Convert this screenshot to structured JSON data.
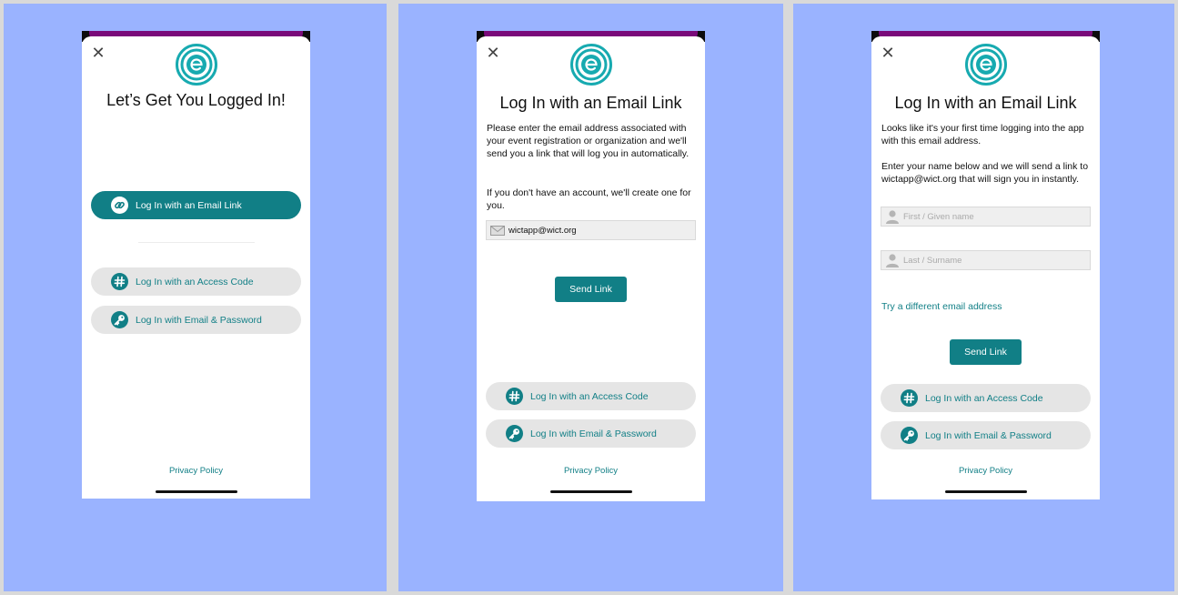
{
  "colors": {
    "background": "#9ab3ff",
    "accent": "#117f86",
    "secondary_button": "#e5e5e5",
    "header_band": "#7a0a7a"
  },
  "icons": {
    "close": "close-icon",
    "logo": "e-logo-icon",
    "link": "link-icon",
    "hash": "hash-icon",
    "key": "key-icon",
    "email": "envelope-icon",
    "person": "person-icon"
  },
  "screen1": {
    "title": "Let’s Get You Logged In!",
    "email_link_button": "Log In with an Email Link",
    "access_code_button": "Log In with an Access Code",
    "email_password_button": "Log In with Email & Password",
    "privacy_policy": "Privacy Policy"
  },
  "screen2": {
    "title": "Log In with an Email Link",
    "paragraph1": "Please enter the email address associated with your event registration or organization and we'll send you a link that will log you in automatically.",
    "paragraph2": "If you don't have an account, we'll create one for you.",
    "email_value": "wictapp@wict.org",
    "send_link_button": "Send Link",
    "access_code_button": "Log In with an Access Code",
    "email_password_button": "Log In with Email & Password",
    "privacy_policy": "Privacy Policy"
  },
  "screen3": {
    "title": "Log In with an Email Link",
    "paragraph1": "Looks like it's your first time logging into the app with this email address.",
    "paragraph2": "Enter your name below and we will send a link to wictapp@wict.org that will sign you in instantly.",
    "first_name_placeholder": "First / Given name",
    "last_name_placeholder": "Last / Surname",
    "different_email_link": "Try a different email address",
    "send_link_button": "Send Link",
    "access_code_button": "Log In with an Access Code",
    "email_password_button": "Log In with Email & Password",
    "privacy_policy": "Privacy Policy"
  }
}
